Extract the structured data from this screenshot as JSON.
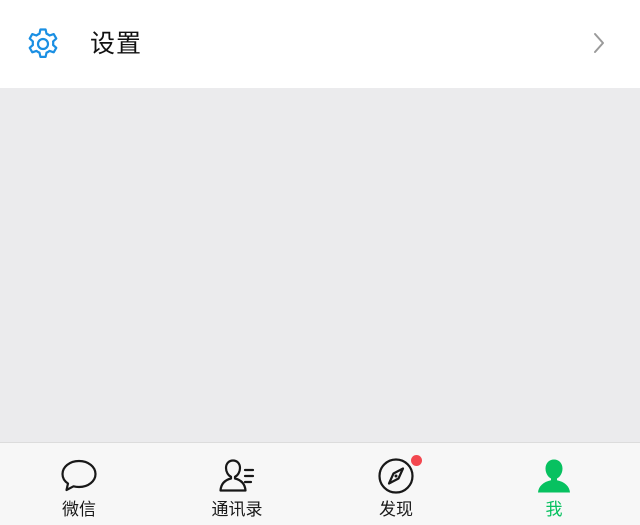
{
  "settings": {
    "label": "设置",
    "icon": "gear-icon",
    "accent": "#1a8fe3"
  },
  "tabbar": {
    "active_color": "#07c160",
    "badge_color": "#f3474f",
    "tabs": [
      {
        "label": "微信",
        "icon": "chat-bubble-icon",
        "active": false
      },
      {
        "label": "通讯录",
        "icon": "contacts-icon",
        "active": false
      },
      {
        "label": "发现",
        "icon": "compass-icon",
        "active": false,
        "has_dot_badge": true
      },
      {
        "label": "我",
        "icon": "person-icon",
        "active": true
      }
    ]
  }
}
